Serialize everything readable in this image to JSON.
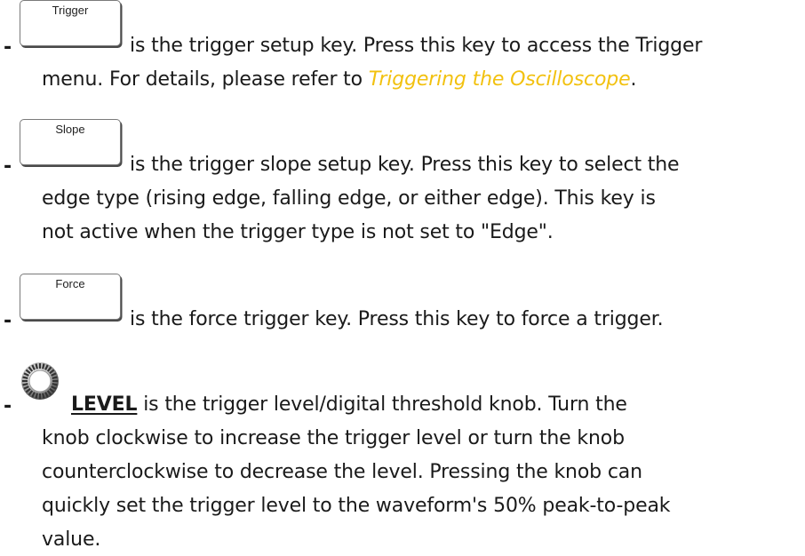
{
  "items": [
    {
      "key_label": "Trigger",
      "lines": [
        "is the trigger setup key. Press this key to access the Trigger",
        "menu. For details, please refer to "
      ],
      "link_text": "Triggering the Oscilloscope",
      "after_link": "."
    },
    {
      "key_label": "Slope",
      "lines": [
        "is the trigger slope setup key. Press this key to select the",
        "edge type (rising edge, falling edge, or either edge). This key is",
        "not active when the trigger type is not set to \"Edge\"."
      ]
    },
    {
      "key_label": "Force",
      "lines": [
        "is the force trigger key. Press this key to force a trigger."
      ]
    },
    {
      "knob_label": "LEVEL",
      "lines": [
        " is the trigger level/digital threshold knob. Turn the",
        "knob clockwise to increase the trigger level or turn the knob",
        "counterclockwise to decrease the level. Pressing the knob can",
        "quickly set the trigger level to the waveform's 50% peak-to-peak",
        "value."
      ]
    }
  ],
  "bullet": "-",
  "colors": {
    "link": "#f2c10f",
    "text": "#1a1a1a"
  },
  "icons": {
    "knob": "knob-icon"
  }
}
